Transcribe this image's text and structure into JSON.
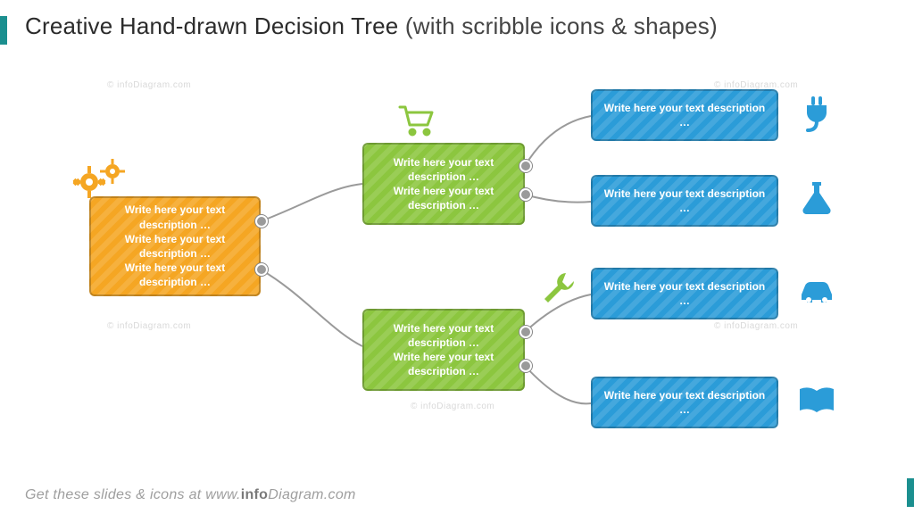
{
  "title": {
    "main": "Creative Hand-drawn Decision Tree",
    "sub": "(with scribble icons & shapes)"
  },
  "footer": {
    "prefix": "Get these slides & icons at ",
    "brand_prefix": "www.",
    "brand_bold": "info",
    "brand_rest": "Diagram.com"
  },
  "watermark": "© infoDiagram.com",
  "nodes": {
    "root": "Write here your text description …\nWrite here your text description …\nWrite here your text description …",
    "mid_top": "Write here your text description …\nWrite here your text description …",
    "mid_bottom": "Write here your text description …\nWrite here your text description …",
    "leaf1": "Write here your text description …",
    "leaf2": "Write here your text description …",
    "leaf3": "Write here your text description …",
    "leaf4": "Write here your text description …"
  },
  "icons": {
    "gears": "gears-icon",
    "cart": "cart-icon",
    "plug": "plug-icon",
    "flask": "flask-icon",
    "wrench": "wrench-icon",
    "car": "car-icon",
    "book": "book-icon"
  }
}
